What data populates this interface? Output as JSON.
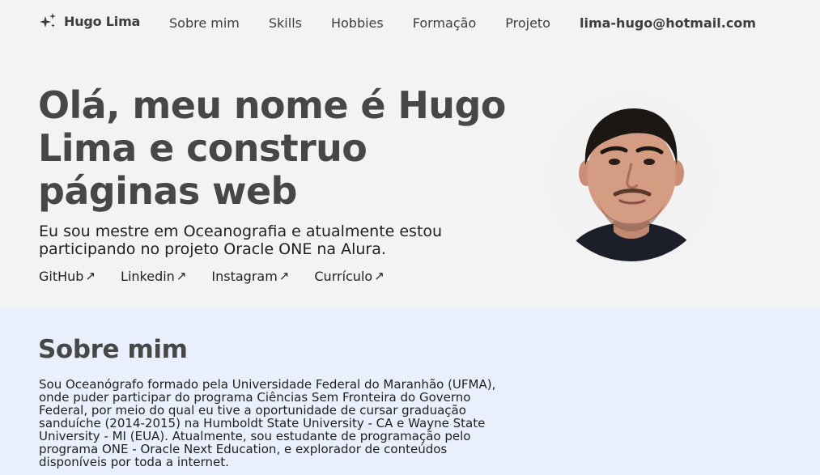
{
  "nav": {
    "brand_icon": "sparkles-icon",
    "brand_name": "Hugo Lima",
    "items": [
      {
        "label": "Sobre mim"
      },
      {
        "label": "Skills"
      },
      {
        "label": "Hobbies"
      },
      {
        "label": "Formação"
      },
      {
        "label": "Projeto"
      }
    ],
    "email": "lima-hugo@hotmail.com"
  },
  "hero": {
    "title": "Olá, meu nome é Hugo Lima e construo páginas web",
    "lead": "Eu sou mestre em Oceanografia e atualmente estou participando no projeto Oracle ONE na Alura.",
    "links": [
      {
        "label": "GitHub",
        "icon": "arrow-up-right-icon"
      },
      {
        "label": "Linkedin",
        "icon": "arrow-up-right-icon"
      },
      {
        "label": "Instagram",
        "icon": "arrow-up-right-icon"
      },
      {
        "label": "Currículo",
        "icon": "arrow-up-right-icon"
      }
    ],
    "avatar": "profile-photo"
  },
  "about": {
    "title": "Sobre mim",
    "text": "Sou Oceanógrafo formado pela Universidade Federal do Maranhão (UFMA), onde puder participar do programa Ciências Sem Fronteira do Governo Federal, por meio do qual eu tive a oportunidade de cursar graduação sanduíche (2014-2015) na Humboldt State University - CA e Wayne State University - MI (EUA). Atualmente, sou estudante de programação pelo programa ONE - Oracle Next Education, e explorador de conteúdos disponíveis por toda a internet."
  },
  "colors": {
    "page_bg": "#f3f3f3",
    "about_bg": "#e9f0fb",
    "heading": "#474747",
    "text": "#1f1f1f"
  }
}
